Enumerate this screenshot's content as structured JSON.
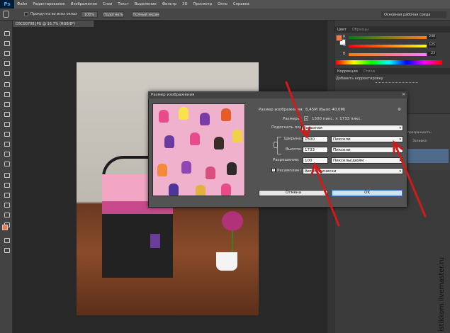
{
  "app": {
    "logo": "Ps"
  },
  "menu": [
    "Файл",
    "Редактирование",
    "Изображение",
    "Слои",
    "Текст",
    "Выделение",
    "Фильтр",
    "3D",
    "Просмотр",
    "Окно",
    "Справка"
  ],
  "options_bar": {
    "scroll_all": "Прокрутка во всех окнах",
    "zoom_value": "100%",
    "fit_button": "Подогнать",
    "fullscreen_button": "Полный экран",
    "workspace": "Основная рабочая среда"
  },
  "document_tab": "DSC00708.JPG @ 16,7% (RGB/8*)",
  "panels": {
    "color_tabs": [
      "Цвет",
      "Образцы"
    ],
    "color_letters": [
      "R",
      "G",
      "B"
    ],
    "color_values": [
      "248",
      "125",
      "23"
    ],
    "correction_tabs": [
      "Коррекция",
      "Стили"
    ],
    "add_correction": "Добавить корректировку",
    "layers_fragments": [
      "прозрачность:",
      "Заливка:"
    ]
  },
  "dialog": {
    "title": "Размер изображения",
    "size_label": "Размер изображения:",
    "size_value": "6,45М (было 40,0М)",
    "dims_label": "Размеры:",
    "dims_value": "1300 пикс. × 1733 пикс.",
    "fit_label": "Подогнать под:",
    "fit_value": "Заказная",
    "width_label": "Ширина:",
    "width_value": "1300",
    "width_unit": "Пиксели",
    "height_label": "Высота:",
    "height_value": "1733",
    "height_unit": "Пиксели",
    "resolution_label": "Разрешение:",
    "resolution_value": "100",
    "resolution_unit": "Пикселы/дюйм",
    "resample_label": "Ресамплинг:",
    "resample_value": "Автоматически",
    "cancel": "Отмена",
    "ok": "OK"
  },
  "watermark": "istikkom.livemaster.ru",
  "colors": {
    "accent_orange": "#f27a42",
    "arrow_red": "#d11a1a",
    "ok_blue": "#cfe3f7"
  }
}
